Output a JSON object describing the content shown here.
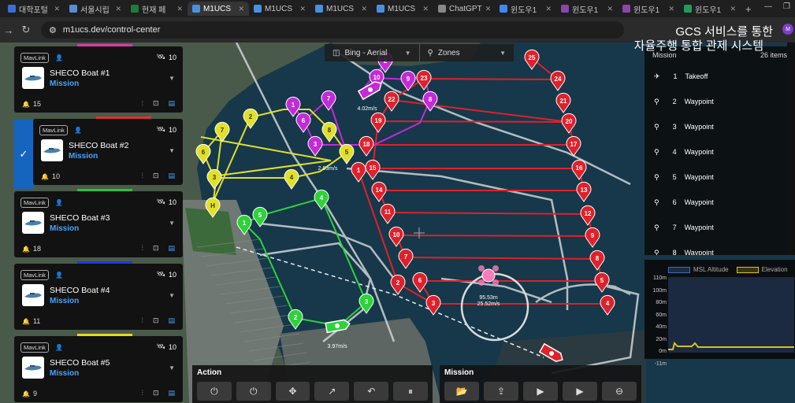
{
  "browser": {
    "tabs": [
      {
        "label": "대학포털",
        "color": "#3a6fd8"
      },
      {
        "label": "서울시립",
        "color": "#5a8bd6"
      },
      {
        "label": "현재 페",
        "color": "#1e7d3a"
      },
      {
        "label": "M1UCS",
        "color": "#4a90e2",
        "active": true
      },
      {
        "label": "M1UCS",
        "color": "#4a90e2"
      },
      {
        "label": "M1UCS",
        "color": "#4a90e2"
      },
      {
        "label": "M1UCS",
        "color": "#4a90e2"
      },
      {
        "label": "ChatGPT",
        "color": "#888888"
      },
      {
        "label": "윈도우1",
        "color": "#4285f4"
      },
      {
        "label": "윈도우1",
        "color": "#8e44ad"
      },
      {
        "label": "윈도우1",
        "color": "#8e44ad"
      },
      {
        "label": "윈도우1",
        "color": "#1e9d5a"
      }
    ],
    "new_tab": "+",
    "url": "m1ucs.dev/control-center",
    "avatar": "M"
  },
  "overlay_title": {
    "line1": "GCS 서비스를 통한",
    "line2": "자율주행 통합 관제 시스템"
  },
  "layers": {
    "base": "Bing - Aerial",
    "zones": "Zones"
  },
  "vehicles": [
    {
      "name": "SHECO Boat #1",
      "mode": "Mission",
      "link": "MavLink",
      "count": "10",
      "alerts": "15",
      "bar_color": "#d63aa8",
      "top": 0
    },
    {
      "name": "SHECO Boat #2",
      "mode": "Mission",
      "link": "MavLink",
      "count": "10",
      "alerts": "10",
      "bar_color": "#e03030",
      "top": 92,
      "selected": true
    },
    {
      "name": "SHECO Boat #3",
      "mode": "Mission",
      "link": "MavLink",
      "count": "10",
      "alerts": "18",
      "bar_color": "#27c43a",
      "top": 184
    },
    {
      "name": "SHECO Boat #4",
      "mode": "Mission",
      "link": "MavLink",
      "count": "10",
      "alerts": "11",
      "bar_color": "#1e3adf",
      "top": 276
    },
    {
      "name": "SHECO Boat #5",
      "mode": "Mission",
      "link": "MavLink",
      "count": "10",
      "alerts": "9",
      "bar_color": "#e8d820",
      "top": 368
    }
  ],
  "mission": {
    "title": "Mission",
    "count": "26 items",
    "items": [
      {
        "num": "1",
        "type": "Takeoff"
      },
      {
        "num": "2",
        "type": "Waypoint"
      },
      {
        "num": "3",
        "type": "Waypoint"
      },
      {
        "num": "4",
        "type": "Waypoint"
      },
      {
        "num": "5",
        "type": "Waypoint"
      },
      {
        "num": "6",
        "type": "Waypoint"
      },
      {
        "num": "7",
        "type": "Waypoint"
      },
      {
        "num": "8",
        "type": "Waypoint"
      }
    ]
  },
  "elevation": {
    "legend": [
      "MSL Altitude",
      "Elevation"
    ],
    "legend_colors": [
      "#3a6fb0",
      "#d8c020"
    ],
    "y_ticks": [
      "110m",
      "100m",
      "80m",
      "60m",
      "40m",
      "20m",
      "0m",
      "-11m"
    ]
  },
  "map_labels": {
    "speed1": "4.02m/s",
    "speed2": "2.63m/s",
    "speed3": "3.97m/s",
    "dist": "95.53m",
    "speed4": "25.52m/s"
  },
  "markers": {
    "red": [
      "1",
      "2",
      "3",
      "4",
      "5",
      "6",
      "7",
      "8",
      "9",
      "10",
      "11",
      "12",
      "13",
      "14",
      "15",
      "16",
      "17",
      "18",
      "19",
      "20",
      "21",
      "22",
      "23",
      "24",
      "25"
    ],
    "magenta": [
      "1",
      "2",
      "3",
      "6",
      "7",
      "8",
      "9",
      "10"
    ],
    "yellow": [
      "2",
      "3",
      "4",
      "5",
      "6",
      "7",
      "8",
      "H"
    ],
    "green": [
      "1",
      "2",
      "3",
      "4",
      "5"
    ]
  },
  "action_bar": {
    "title": "Action",
    "buttons": [
      "⏻",
      "⏻",
      "✥",
      "↗",
      "↶",
      "⏸"
    ]
  },
  "mission_bar": {
    "title": "Mission",
    "buttons": [
      "📂",
      "⇪",
      "▶",
      "▶",
      "⊖"
    ]
  },
  "colors": {
    "red": "#e0202a",
    "magenta": "#c42ad8",
    "yellow": "#e2e028",
    "green": "#2ed23a",
    "water": "#16384a"
  }
}
